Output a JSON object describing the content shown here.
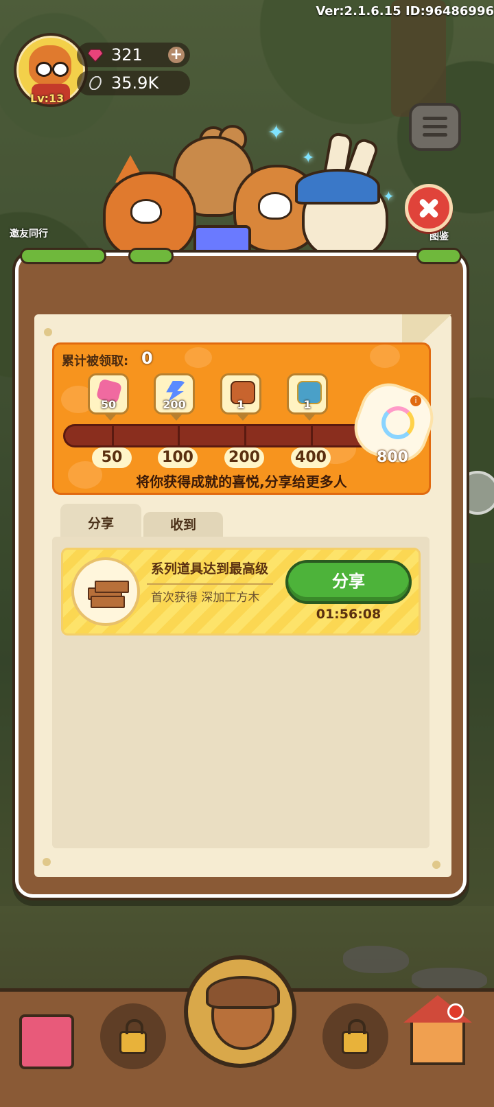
{
  "hud": {
    "version": "Ver:2.1.6.15 ID:96486996",
    "level": "Lv:13",
    "gems": "321",
    "seeds": "35.9K",
    "left_hint": "邀友同行",
    "right_hint": "图鉴"
  },
  "reward": {
    "accum_label": "累计被领取:",
    "accum_value": "0",
    "items": [
      {
        "icon": "pink-gem-icon",
        "count": "50"
      },
      {
        "icon": "blue-energy-icon",
        "count": "200"
      },
      {
        "icon": "wooden-chest-icon",
        "count": "1"
      },
      {
        "icon": "blue-chest-icon",
        "count": "1"
      }
    ],
    "milestones": [
      "50",
      "100",
      "200",
      "400",
      "800"
    ],
    "final_icon": "rainbow-ring-icon",
    "progress": 0,
    "slogan": "将你获得成就的喜悦,分享给更多人"
  },
  "tabs": [
    {
      "label": "分享",
      "active": true
    },
    {
      "label": "收到",
      "active": false
    }
  ],
  "list": [
    {
      "icon": "wood-planks-icon",
      "title": "系列道具达到最高级",
      "subtitle": "首次获得 深加工方木",
      "button": "分享",
      "timer": "01:56:08"
    }
  ],
  "colors": {
    "accent_orange": "#f7941e",
    "share_green": "#4db33a",
    "panel_brown": "#8a5a36",
    "close_red": "#e0433a"
  }
}
